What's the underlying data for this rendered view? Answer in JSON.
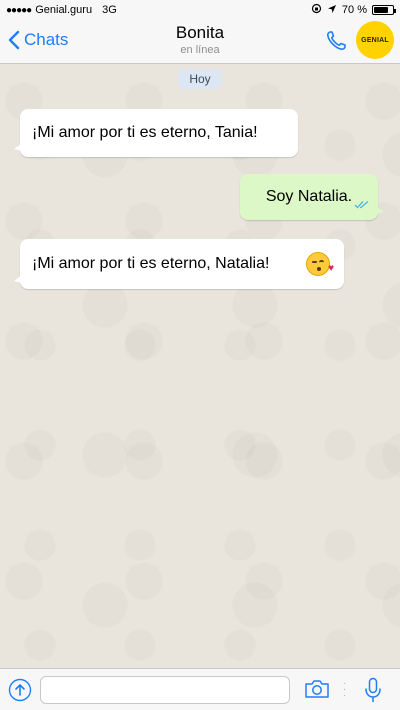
{
  "status_bar": {
    "signal_dots": "●●●●●",
    "carrier": "Genial.guru",
    "network": "3G",
    "battery_text": "70 %",
    "battery_level": 0.7
  },
  "nav": {
    "back_label": "Chats",
    "contact_name": "Bonita",
    "contact_status": "en línea",
    "logo_text": "GENIAL"
  },
  "chat": {
    "date_label": "Hoy",
    "messages": [
      {
        "direction": "incoming",
        "text": "¡Mi amor por ti es eterno, Tania!"
      },
      {
        "direction": "outgoing",
        "text": "Soy Natalia.",
        "status": "read"
      },
      {
        "direction": "incoming",
        "text": "¡Mi amor por ti es eterno, Natalia!",
        "emoji": "kissing-face-with-heart"
      }
    ]
  },
  "input": {
    "placeholder": "",
    "value": ""
  },
  "colors": {
    "accent": "#1e7ef7",
    "outgoing_bubble": "#dcf8c6",
    "incoming_bubble": "#ffffff",
    "chat_background": "#e9e4dc",
    "logo_yellow": "#ffd200"
  }
}
